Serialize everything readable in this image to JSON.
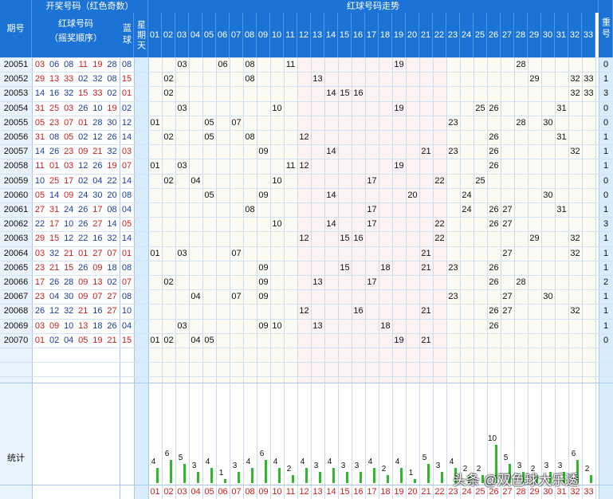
{
  "header": {
    "issue_label": "期号",
    "draw_title": "开奖号码（红色奇数）",
    "red_balls_label": "红球号码",
    "red_balls_sub": "（摇奖顺序）",
    "blue_ball_label": "蓝球",
    "weekday_label": "星期天",
    "trend_title": "红球号码走势",
    "repeat_label": "重号"
  },
  "stats_label": "统计",
  "watermark": "头条 @双色球大乐透",
  "colors": {
    "header_blue": "#1b73d6",
    "odd_red": "#cc1e1e",
    "bar_green": "#2eb82e"
  },
  "chart_data": {
    "type": "table",
    "columns": [
      "01",
      "02",
      "03",
      "04",
      "05",
      "06",
      "07",
      "08",
      "09",
      "10",
      "11",
      "12",
      "13",
      "14",
      "15",
      "16",
      "17",
      "18",
      "19",
      "20",
      "21",
      "22",
      "23",
      "24",
      "25",
      "26",
      "27",
      "28",
      "29",
      "30",
      "31",
      "32",
      "33"
    ],
    "rows": [
      {
        "issue": "20051",
        "reds": [
          "03",
          "06",
          "08",
          "11",
          "19",
          "28"
        ],
        "blue": "08",
        "repeat": "0"
      },
      {
        "issue": "20052",
        "reds": [
          "29",
          "13",
          "33",
          "02",
          "32",
          "08"
        ],
        "blue": "15",
        "repeat": "1"
      },
      {
        "issue": "20053",
        "reds": [
          "14",
          "16",
          "32",
          "15",
          "33",
          "02"
        ],
        "blue": "01",
        "repeat": "3"
      },
      {
        "issue": "20054",
        "reds": [
          "31",
          "25",
          "03",
          "26",
          "10",
          "19"
        ],
        "blue": "02",
        "repeat": "0"
      },
      {
        "issue": "20055",
        "reds": [
          "05",
          "23",
          "07",
          "01",
          "28",
          "30"
        ],
        "blue": "12",
        "repeat": "0"
      },
      {
        "issue": "20056",
        "reds": [
          "31",
          "08",
          "05",
          "02",
          "12",
          "26"
        ],
        "blue": "14",
        "repeat": "1"
      },
      {
        "issue": "20057",
        "reds": [
          "14",
          "26",
          "23",
          "09",
          "21",
          "32"
        ],
        "blue": "03",
        "repeat": "1"
      },
      {
        "issue": "20058",
        "reds": [
          "11",
          "01",
          "03",
          "12",
          "26",
          "19"
        ],
        "blue": "07",
        "repeat": "1"
      },
      {
        "issue": "20059",
        "reds": [
          "10",
          "25",
          "17",
          "02",
          "04",
          "22"
        ],
        "blue": "14",
        "repeat": "0"
      },
      {
        "issue": "20060",
        "reds": [
          "05",
          "14",
          "09",
          "24",
          "30",
          "20"
        ],
        "blue": "08",
        "repeat": "0"
      },
      {
        "issue": "20061",
        "reds": [
          "27",
          "31",
          "24",
          "26",
          "17",
          "08"
        ],
        "blue": "04",
        "repeat": "1"
      },
      {
        "issue": "20062",
        "reds": [
          "22",
          "17",
          "10",
          "26",
          "27",
          "14"
        ],
        "blue": "05",
        "repeat": "3"
      },
      {
        "issue": "20063",
        "reds": [
          "29",
          "15",
          "12",
          "22",
          "16",
          "32"
        ],
        "blue": "14",
        "repeat": "1"
      },
      {
        "issue": "20064",
        "reds": [
          "03",
          "32",
          "21",
          "01",
          "27",
          "07"
        ],
        "blue": "01",
        "repeat": "1"
      },
      {
        "issue": "20065",
        "reds": [
          "23",
          "21",
          "15",
          "26",
          "09",
          "18"
        ],
        "blue": "08",
        "repeat": "1"
      },
      {
        "issue": "20066",
        "reds": [
          "17",
          "26",
          "28",
          "09",
          "13",
          "02"
        ],
        "blue": "07",
        "repeat": "2"
      },
      {
        "issue": "20067",
        "reds": [
          "23",
          "04",
          "30",
          "09",
          "07",
          "27"
        ],
        "blue": "08",
        "repeat": "1"
      },
      {
        "issue": "20068",
        "reds": [
          "26",
          "12",
          "32",
          "21",
          "16",
          "27"
        ],
        "blue": "10",
        "repeat": "1"
      },
      {
        "issue": "20069",
        "reds": [
          "03",
          "09",
          "10",
          "13",
          "18",
          "26"
        ],
        "blue": "04",
        "repeat": "1"
      },
      {
        "issue": "20070",
        "reds": [
          "01",
          "02",
          "04",
          "05",
          "19",
          "21"
        ],
        "blue": "15",
        "repeat": "0"
      }
    ],
    "counts": [
      4,
      6,
      5,
      3,
      4,
      1,
      3,
      4,
      6,
      4,
      2,
      4,
      3,
      4,
      3,
      3,
      4,
      2,
      4,
      1,
      5,
      3,
      4,
      2,
      2,
      10,
      5,
      3,
      2,
      3,
      3,
      6,
      2
    ]
  }
}
